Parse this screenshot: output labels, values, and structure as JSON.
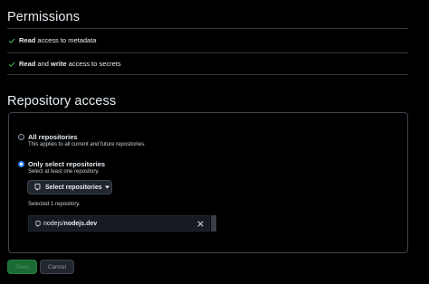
{
  "permissions": {
    "heading": "Permissions",
    "items": [
      {
        "parts": [
          {
            "text": "Read",
            "bold": true
          },
          {
            "text": " access to metadata",
            "bold": false
          }
        ]
      },
      {
        "parts": [
          {
            "text": "Read",
            "bold": true
          },
          {
            "text": " and ",
            "bold": false
          },
          {
            "text": "write",
            "bold": true
          },
          {
            "text": " access to secrets",
            "bold": false
          }
        ]
      }
    ]
  },
  "repository_access": {
    "heading": "Repository access",
    "options": {
      "all": {
        "label": "All repositories",
        "desc_before": "This applies to all current ",
        "desc_em": "and",
        "desc_after": " future repositories.",
        "checked": false
      },
      "select": {
        "label": "Only select repositories",
        "desc": "Select at least one repository.",
        "checked": true
      }
    },
    "select_button_label": "Select repositories",
    "selected_count_text": "Selected 1 repository.",
    "selected_repos": [
      {
        "owner": "nodejs/",
        "name": "nodejs.dev"
      }
    ]
  },
  "actions": {
    "save_label": "Save",
    "cancel_label": "Cancel"
  },
  "icons": {
    "check": "check-icon",
    "repo": "repo-icon",
    "remove": "x-icon",
    "caret": "triangle-down-icon"
  },
  "colors": {
    "background": "#000000",
    "check": "#3fb950",
    "radio_selected": "#2f81f7",
    "save_button": "#1a6b33",
    "border": "#30363d"
  }
}
